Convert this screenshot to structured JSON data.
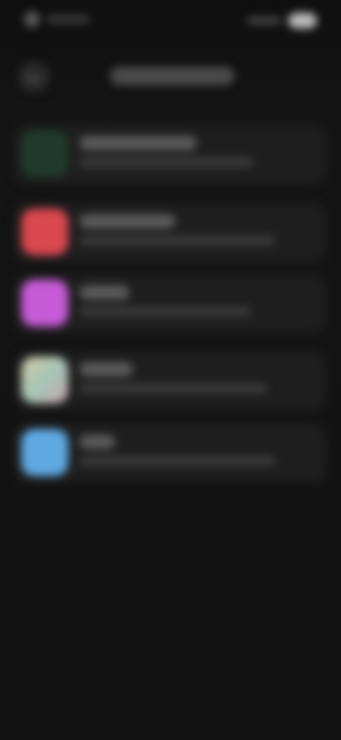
{
  "status_bar": {
    "time": "",
    "battery": ""
  },
  "header": {
    "back_icon": "arrow-left-icon",
    "title": ""
  },
  "apps": [
    {
      "title": "",
      "subtitle": "",
      "icon_color": "#1f3a2b"
    },
    {
      "title": "",
      "subtitle": "",
      "icon_color": "#d9474f"
    },
    {
      "title": "",
      "subtitle": "",
      "icon_color": "#c55bd6"
    },
    {
      "title": "",
      "subtitle": "",
      "icon_color": "#b7b0a6"
    },
    {
      "title": "",
      "subtitle": "",
      "icon_color": "#5fa9e3"
    }
  ],
  "colors": {
    "background": "#121212",
    "card": "#1e1e1e"
  }
}
